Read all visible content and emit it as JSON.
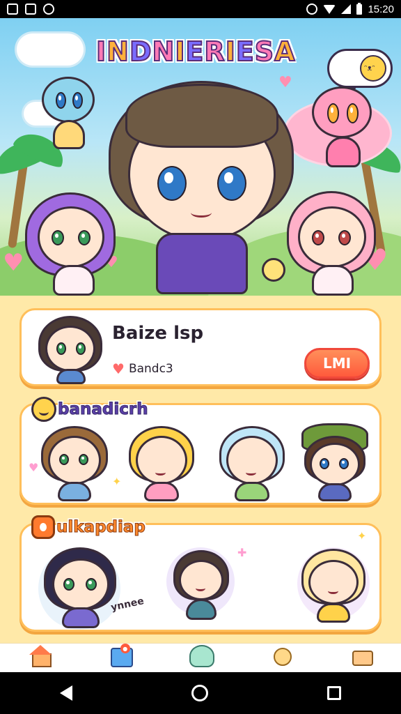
{
  "status_bar": {
    "time": "15:20"
  },
  "hero": {
    "logo": [
      "I",
      "N",
      "D",
      "N",
      "I",
      "E",
      "R",
      "I",
      "E",
      "S",
      "A"
    ]
  },
  "player_card": {
    "name": "Baize lsp",
    "subtitle": "Bandc3",
    "action_label": "LMI"
  },
  "friends_section": {
    "title": "banadicrh"
  },
  "gallery_section": {
    "title": "ulkapdiap",
    "caption": "ynnee"
  },
  "colors": {
    "accent": "#ff5a3c",
    "card_border": "#ffbf5a",
    "background": "#ffe9a8"
  },
  "icons": {
    "status": [
      "photo-icon",
      "app-icon",
      "sync-icon",
      "alarm-icon",
      "wifi-icon",
      "signal-icon",
      "battery-icon"
    ],
    "bottom_nav": [
      "home-icon",
      "shop-icon",
      "character-icon",
      "quest-icon",
      "more-icon"
    ],
    "system_nav": [
      "back-icon",
      "home-circle-icon",
      "recents-icon"
    ]
  }
}
